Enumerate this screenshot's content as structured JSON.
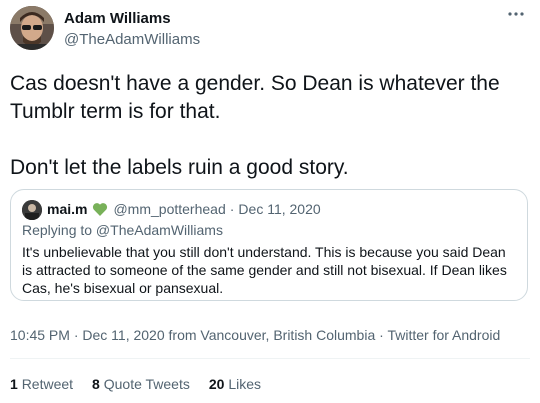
{
  "author": {
    "name": "Adam Williams",
    "handle": "@TheAdamWilliams",
    "avatar_icon": "profile-photo"
  },
  "more_icon": "more-dots-icon",
  "tweet": {
    "line1": "Cas doesn't have a gender. So Dean is whatever the Tumblr term is for that.",
    "line2": "Don't let the labels ruin a good story."
  },
  "quoted_tweet": {
    "name": "mai.m",
    "badge_icon": "green-heart-icon",
    "badge_color": "#78b159",
    "handle": "@mm_potterhead",
    "separator": "·",
    "date": "Dec 11, 2020",
    "replying_to": "Replying to @TheAdamWilliams",
    "text": "It's unbelievable that you still don't understand. This is because you said Dean is attracted to someone of the same gender and still not bisexual. If Dean likes Cas, he's bisexual or pansexual."
  },
  "meta": {
    "time": "10:45 PM",
    "separator": " · ",
    "date": "Dec 11, 2020",
    "location": "from Vancouver, British Columbia",
    "source": "Twitter for Android"
  },
  "stats": {
    "retweets": {
      "count": "1",
      "label": "Retweet"
    },
    "quotes": {
      "count": "8",
      "label": "Quote Tweets"
    },
    "likes": {
      "count": "20",
      "label": "Likes"
    }
  },
  "colors": {
    "text_primary": "#0f1419",
    "text_secondary": "#536471",
    "border": "#cfd9de"
  }
}
